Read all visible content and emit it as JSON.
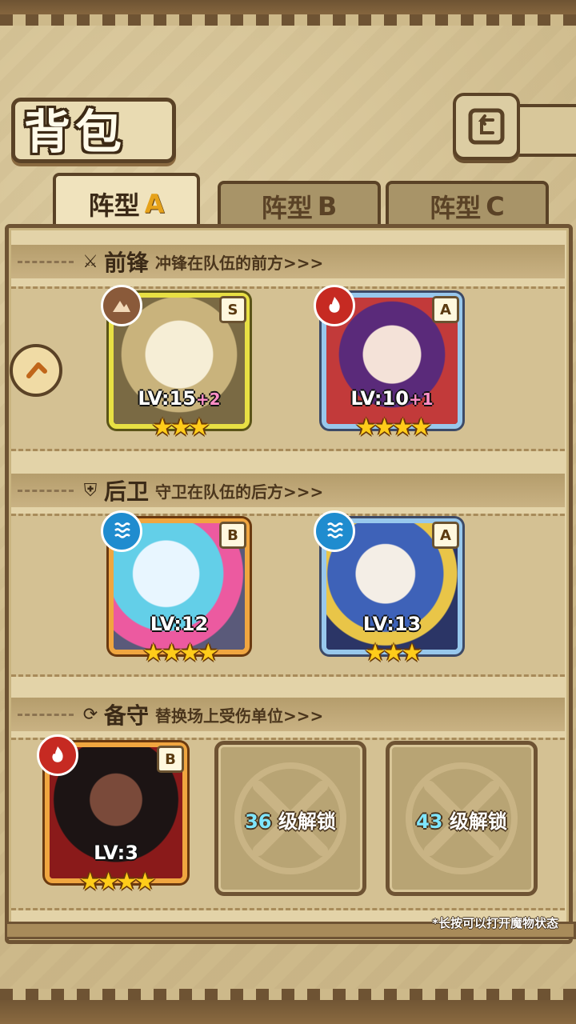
{
  "header": {
    "title": "背包"
  },
  "tabs": [
    {
      "prefix": "阵型",
      "letter": "A",
      "active": true
    },
    {
      "prefix": "阵型",
      "letter": "B",
      "active": false
    },
    {
      "prefix": "阵型",
      "letter": "C",
      "active": false
    }
  ],
  "sections": {
    "front": {
      "name": "前锋",
      "desc": "冲锋在队伍的前方>>>",
      "icon": "sword-icon"
    },
    "back": {
      "name": "后卫",
      "desc": "守卫在队伍的后方>>>",
      "icon": "shield-icon"
    },
    "reserve": {
      "name": "备守",
      "desc": "替换场上受伤单位>>>",
      "icon": "swap-icon"
    }
  },
  "cards": [
    {
      "rank": "S",
      "element": "earth",
      "lv": "LV:15",
      "plus": "+2",
      "stars": "★★★",
      "star_count": 3
    },
    {
      "rank": "A",
      "element": "fire",
      "lv": "LV:10",
      "plus": "+1",
      "stars": "★★★★",
      "star_count": 4
    },
    {
      "rank": "B",
      "element": "water",
      "lv": "LV:12",
      "plus": "",
      "stars": "★★★★",
      "star_count": 4
    },
    {
      "rank": "A",
      "element": "water",
      "lv": "LV:13",
      "plus": "",
      "stars": "★★★",
      "star_count": 3
    },
    {
      "rank": "B",
      "element": "fire",
      "lv": "LV:3",
      "plus": "",
      "stars": "★★★★",
      "star_count": 4
    }
  ],
  "locked_slots": [
    {
      "level": "36",
      "text": "级解锁"
    },
    {
      "level": "43",
      "text": "级解锁"
    }
  ],
  "footer_hint": "*长按可以打开魔物状态",
  "colors": {
    "gold": "#e6a21a",
    "panel": "#e3d3a8",
    "frame_dark": "#5a4226"
  }
}
